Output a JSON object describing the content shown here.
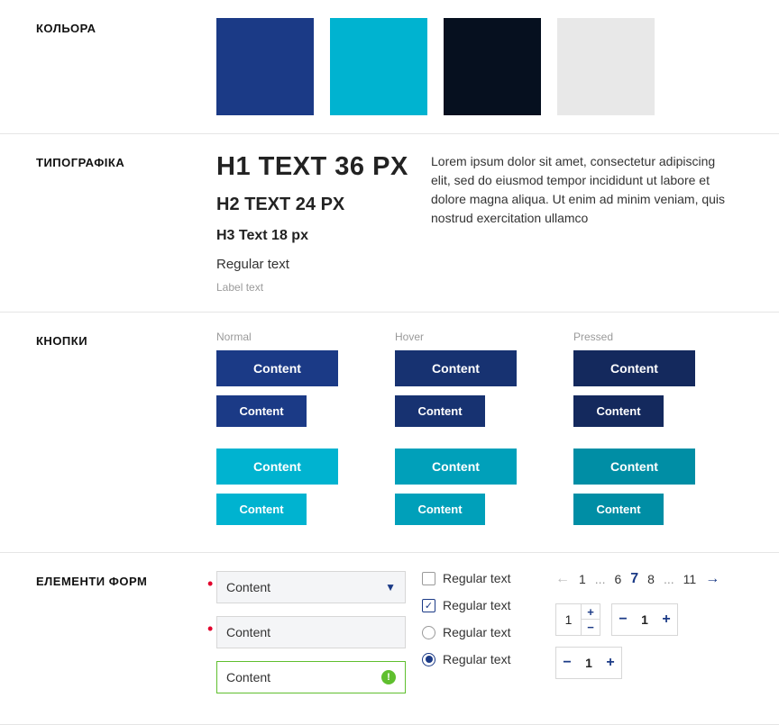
{
  "sections": {
    "colors": {
      "label": "КОЛЬОРА"
    },
    "typography": {
      "label": "ТИПОГРАФІКА",
      "h1": "H1 TEXT 36 PX",
      "h2": "H2 TEXT 24 PX",
      "h3": "H3 Text 18 px",
      "regular": "Regular text",
      "label_text": "Label text",
      "paragraph": "Lorem ipsum dolor sit amet, consectetur adipiscing elit, sed do eiusmod tempor incididunt ut labore et dolore magna aliqua. Ut enim ad minim veniam, quis nostrud exercitation ullamco"
    },
    "buttons": {
      "label": "КНОПКИ",
      "states": {
        "normal": "Normal",
        "hover": "Hover",
        "pressed": "Pressed"
      },
      "content": "Content"
    },
    "forms": {
      "label": "ЕЛЕМЕНТИ ФОРМ",
      "input_text": "Content",
      "check_label": "Regular text",
      "pagination": {
        "p1": "1",
        "dots": "...",
        "p6": "6",
        "p7": "7",
        "p8": "8",
        "p11": "11"
      },
      "stepper_value": "1"
    }
  },
  "colors": {
    "blue": "#1b3a86",
    "cyan": "#00b3d0",
    "dark": "#06101f",
    "grey": "#e8e8e8"
  }
}
